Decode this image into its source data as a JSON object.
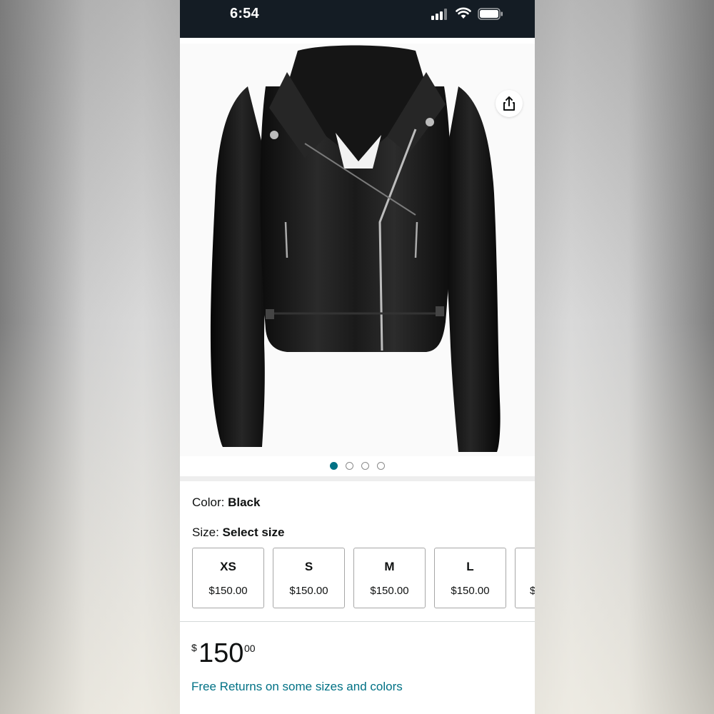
{
  "status_bar": {
    "time": "6:54"
  },
  "product_image": {
    "carousel_dots": 4,
    "active_dot": 1
  },
  "color": {
    "label": "Color: ",
    "value": "Black"
  },
  "size": {
    "label": "Size: ",
    "value": "Select size",
    "options": [
      {
        "name": "XS",
        "price": "$150.00"
      },
      {
        "name": "S",
        "price": "$150.00"
      },
      {
        "name": "M",
        "price": "$150.00"
      },
      {
        "name": "L",
        "price": "$150.00"
      },
      {
        "name": "",
        "price": "$"
      }
    ]
  },
  "price": {
    "symbol": "$",
    "whole": "150",
    "fraction": "00"
  },
  "free_returns": "Free Returns on some sizes and colors",
  "colors": {
    "status_bar_bg": "#141c24",
    "link": "#007185",
    "active_dot": "#007185"
  }
}
